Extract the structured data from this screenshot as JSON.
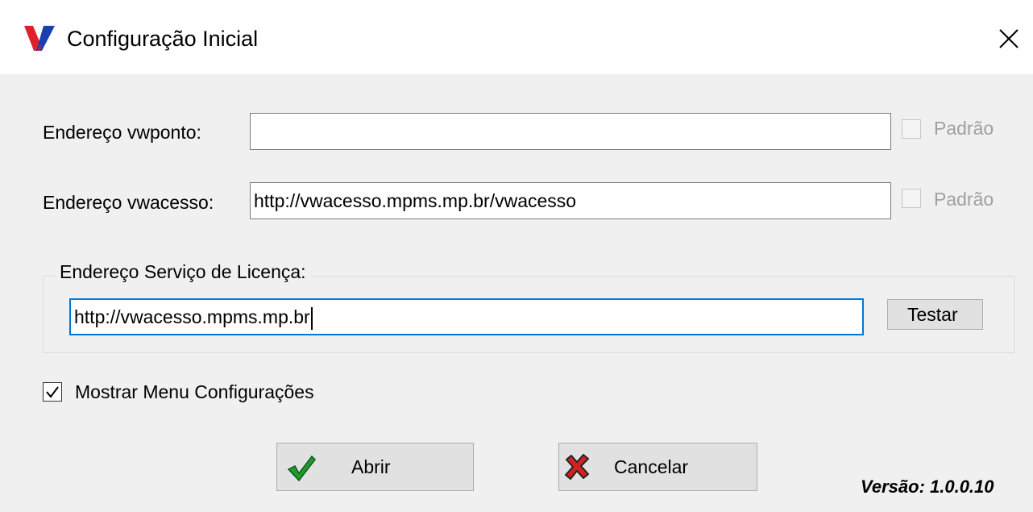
{
  "window": {
    "title": "Configuração Inicial"
  },
  "fields": {
    "vwponto_label": "Endereço vwponto:",
    "vwponto_value": "",
    "vwponto_default_label": "Padrão",
    "vwponto_default_checked": false,
    "vwacesso_label": "Endereço vwacesso:",
    "vwacesso_value": "http://vwacesso.mpms.mp.br/vwacesso",
    "vwacesso_default_label": "Padrão",
    "vwacesso_default_checked": false
  },
  "license": {
    "group_label": "Endereço Serviço de Licença:",
    "url_value": "http://vwacesso.mpms.mp.br",
    "test_button": "Testar"
  },
  "options": {
    "show_menu_label": "Mostrar Menu Configurações",
    "show_menu_checked": true
  },
  "buttons": {
    "open": "Abrir",
    "cancel": "Cancelar"
  },
  "footer": {
    "version": "Versão: 1.0.0.10"
  },
  "colors": {
    "accent_focus": "#0078d7",
    "logo_red": "#e0202a",
    "logo_blue": "#1a3fae",
    "check_green": "#1f9a2e",
    "cancel_red": "#d42020"
  },
  "icons": {
    "app": "vw-logo-icon",
    "close": "close-icon",
    "open": "green-checkmark-icon",
    "cancel": "red-x-icon"
  }
}
